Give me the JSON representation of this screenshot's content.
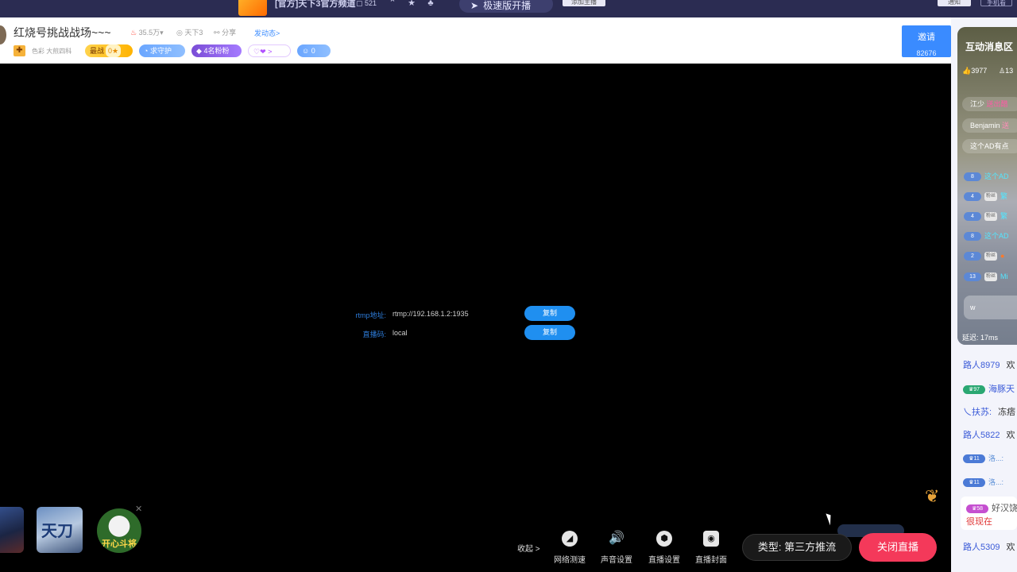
{
  "topbar": {
    "channel_title": "[官方]天下3官方频道",
    "viewer_count": "521",
    "speed_button": "极速版开播",
    "add_host": "添加主播",
    "notify": "通知",
    "mobile": "手机看"
  },
  "header": {
    "room_title": "红烧号挑战战场~~~",
    "hot_count": "35.5万",
    "area": "天下3",
    "share": "分享",
    "post": "发动态>",
    "category": "色彩 大煎四科",
    "rank_label": "最战",
    "rank_level": "0",
    "guard_label": "求守护",
    "fans_label": "4名粉粉",
    "gift_label": ">",
    "user_count": "0",
    "invite_label": "邀请",
    "invite_count": "82676"
  },
  "stream": {
    "rtmp_label": "rtmp地址:",
    "rtmp_value": "rtmp://192.168.1.2:1935",
    "key_label": "直播码:",
    "key_value": "local",
    "copy_label": "复制"
  },
  "games": {
    "game2_title": "天刀",
    "game3_title": "开心斗将"
  },
  "toolbar": {
    "collapse": "收起 >",
    "net_test": "网络测速",
    "audio": "声音设置",
    "live_settings": "直播设置",
    "cover": "直播封面",
    "type": "类型: 第三方推流",
    "close_live": "关闭直播"
  },
  "interaction": {
    "title": "互动消息区",
    "likes": "3977",
    "viewers": "13",
    "rows": [
      {
        "user": "江少",
        "text": "送出醋"
      },
      {
        "user": "Benjamin",
        "text": "送"
      },
      {
        "user": "",
        "text": "这个AD有点"
      }
    ],
    "items": [
      {
        "level": "8",
        "fans": "",
        "text": "这个AD"
      },
      {
        "level": "4",
        "fans": "粉丝",
        "text": "繁"
      },
      {
        "level": "4",
        "fans": "粉丝",
        "text": "繁"
      },
      {
        "level": "8",
        "fans": "",
        "text": "这个AD"
      },
      {
        "level": "2",
        "fans": "粉丝",
        "text": "●"
      },
      {
        "level": "13",
        "fans": "粉丝",
        "text": "Mi"
      }
    ],
    "input_value": "w",
    "delay": "延迟: 17ms"
  },
  "chat": [
    {
      "user": "路人8979",
      "text": "欢"
    },
    {
      "user": "海豚天",
      "text": ""
    },
    {
      "user": "乀扶苏:",
      "text": "冻痞"
    },
    {
      "user": "路人5822",
      "text": "欢"
    },
    {
      "user": "洛...:",
      "text": ""
    },
    {
      "user": "洛...:",
      "text": ""
    },
    {
      "user": "好汉饶",
      "text": "很现在"
    },
    {
      "user": "路人5309",
      "text": "欢"
    }
  ]
}
